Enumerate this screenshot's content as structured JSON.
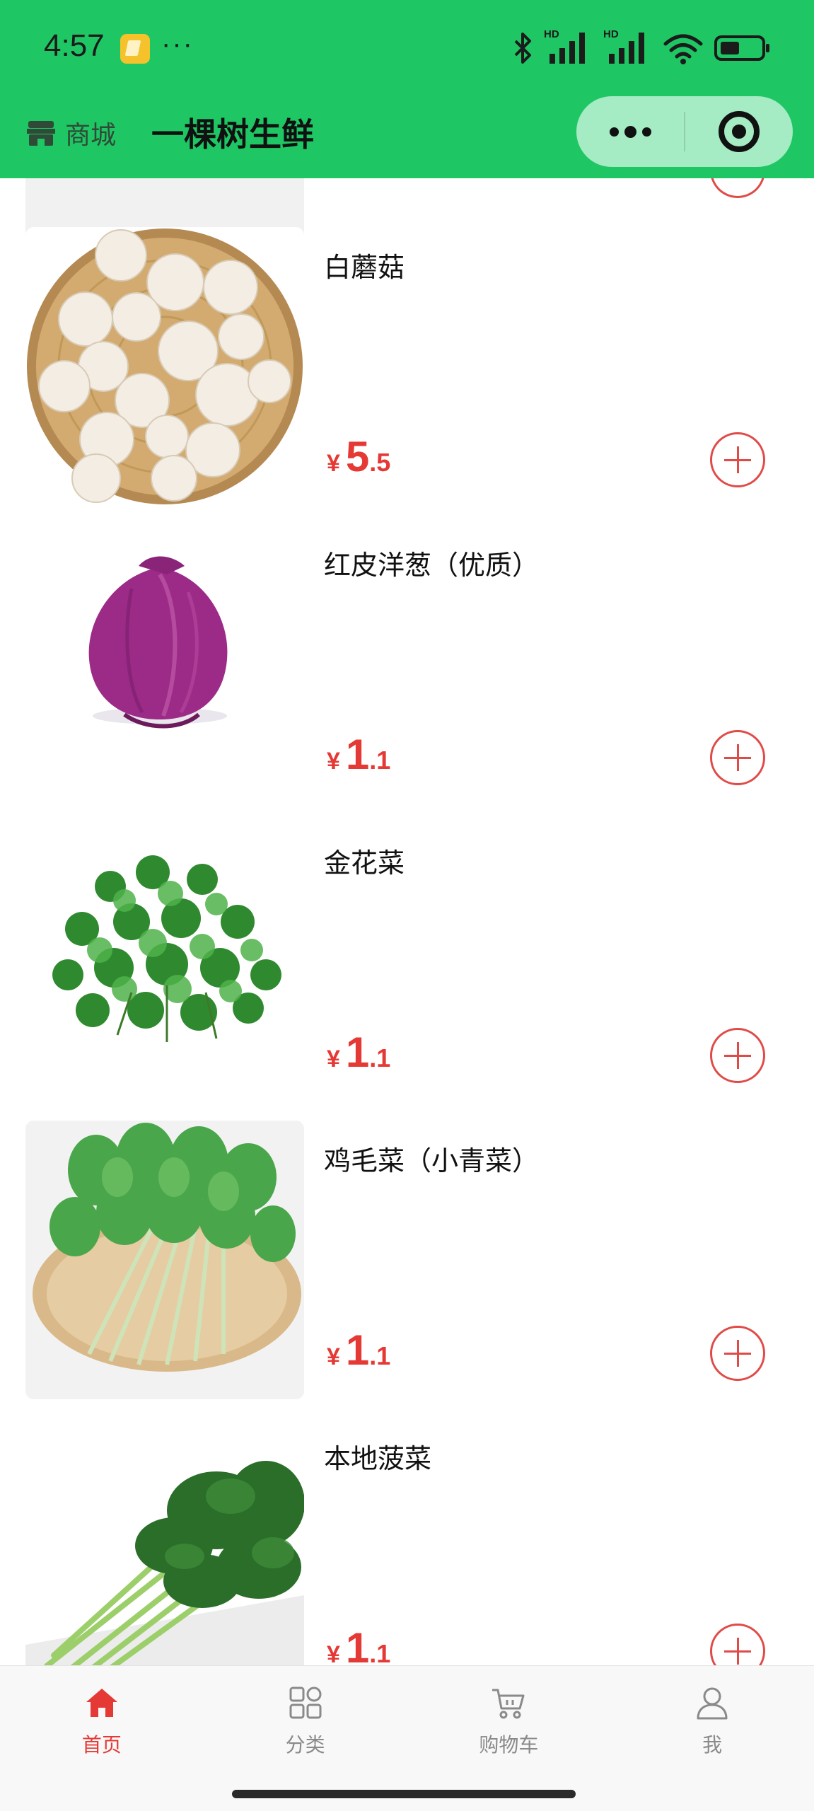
{
  "status_bar": {
    "time": "4:57",
    "dots": "···",
    "signal_labels": [
      "HD",
      "HD"
    ],
    "icons": [
      "app-notification-icon",
      "bluetooth-icon",
      "signal-icon",
      "wifi-icon",
      "battery-icon"
    ]
  },
  "nav": {
    "home_label": "商城",
    "title": "一棵树生鲜",
    "home_icon": "store-icon",
    "more_icon": "more-icon",
    "close_icon": "close-miniprogram-icon",
    "colors": {
      "header_bg": "#1ec764",
      "capsule_bg": "#a5ebc3"
    }
  },
  "products": [
    {
      "name": "白蘑菇",
      "price_symbol": "¥",
      "price_int": "5",
      "price_dec": ".5",
      "image": "white-mushroom-image"
    },
    {
      "name": "红皮洋葱（优质）",
      "price_symbol": "¥",
      "price_int": "1",
      "price_dec": ".1",
      "image": "red-onion-image"
    },
    {
      "name": "金花菜",
      "price_symbol": "¥",
      "price_int": "1",
      "price_dec": ".1",
      "image": "clover-greens-image"
    },
    {
      "name": "鸡毛菜（小青菜）",
      "price_symbol": "¥",
      "price_int": "1",
      "price_dec": ".1",
      "image": "baby-bok-choy-image"
    },
    {
      "name": "本地菠菜",
      "price_symbol": "¥",
      "price_int": "1",
      "price_dec": ".1",
      "image": "spinach-image"
    }
  ],
  "tabs": [
    {
      "label": "首页",
      "icon": "home-icon",
      "active": true
    },
    {
      "label": "分类",
      "icon": "category-icon",
      "active": false
    },
    {
      "label": "购物车",
      "icon": "cart-icon",
      "active": false
    },
    {
      "label": "我",
      "icon": "user-icon",
      "active": false
    }
  ],
  "colors": {
    "price": "#e53935",
    "tab_active": "#e53935",
    "tab_inactive": "#8a8a8a"
  }
}
